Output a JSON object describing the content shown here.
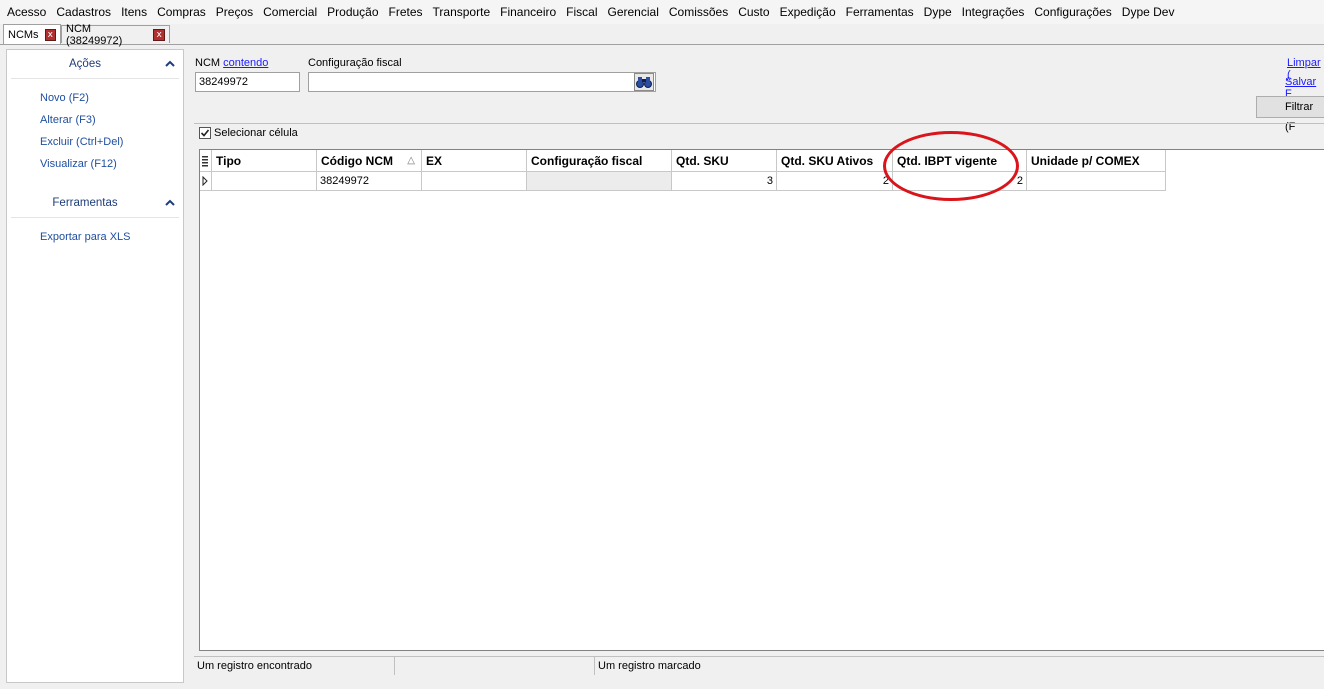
{
  "menu": [
    "Acesso",
    "Cadastros",
    "Itens",
    "Compras",
    "Preços",
    "Comercial",
    "Produção",
    "Fretes",
    "Transporte",
    "Financeiro",
    "Fiscal",
    "Gerencial",
    "Comissões",
    "Custo",
    "Expedição",
    "Ferramentas",
    "Dype",
    "Integrações",
    "Configurações",
    "Dype Dev"
  ],
  "tabs": [
    {
      "label": "NCMs",
      "close": "x"
    },
    {
      "label": "NCM (38249972)",
      "close": "x"
    }
  ],
  "sidebar": {
    "actions_title": "Ações",
    "actions": [
      "Novo (F2)",
      "Alterar (F3)",
      "Excluir (Ctrl+Del)",
      "Visualizar (F12)"
    ],
    "tools_title": "Ferramentas",
    "tools": [
      "Exportar para XLS"
    ]
  },
  "filter": {
    "ncm_label": "NCM",
    "ncm_mode": "contendo",
    "ncm_value": "38249972",
    "config_label": "Configuração fiscal",
    "config_value": "",
    "clear_link": "Limpar (",
    "save_link": "Salvar F",
    "filter_button": "Filtrar (F"
  },
  "grid": {
    "select_cell_label": "Selecionar célula",
    "columns": [
      "Tipo",
      "Código NCM",
      "EX",
      "Configuração fiscal",
      "Qtd. SKU",
      "Qtd. SKU Ativos",
      "Qtd. IBPT vigente",
      "Unidade p/ COMEX"
    ],
    "sort_indicator": "△",
    "rows": [
      {
        "tipo": "",
        "codigo": "38249972",
        "ex": "",
        "config": "",
        "qtd_sku": "3",
        "qtd_sku_ativos": "2",
        "qtd_ibpt": "2",
        "unidade": ""
      }
    ]
  },
  "status": {
    "found": "Um registro encontrado",
    "middle": "",
    "marked": "Um registro marcado"
  },
  "colors": {
    "highlight": "#d9141a",
    "link": "#1a1aff",
    "sidebar_link": "#1f4fa0"
  }
}
